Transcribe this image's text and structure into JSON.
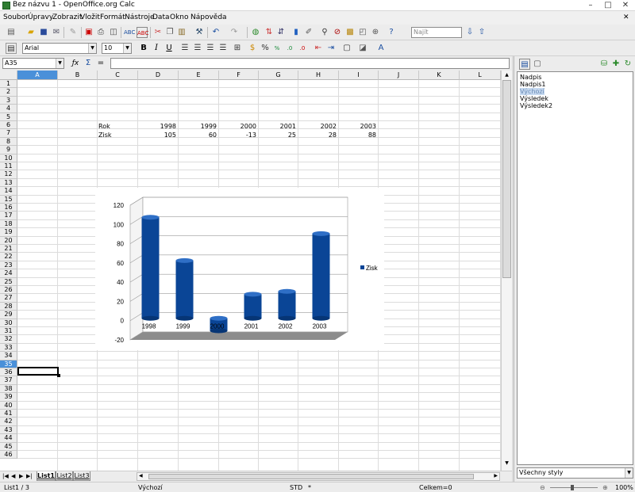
{
  "window": {
    "title": "Bez názvu 1 - OpenOffice.org Calc"
  },
  "menu": [
    "Soubor",
    "Úpravy",
    "Zobrazit",
    "Vložit",
    "Formát",
    "Nástroje",
    "Data",
    "Okno",
    "Nápověda"
  ],
  "toolbar": {
    "find_placeholder": "Najít"
  },
  "formatting": {
    "font_name": "Arial",
    "font_size": "10"
  },
  "formula_bar": {
    "name_box": "A35",
    "formula": ""
  },
  "sheet": {
    "columns": [
      "A",
      "B",
      "C",
      "D",
      "E",
      "F",
      "G",
      "H",
      "I",
      "J",
      "K",
      "L"
    ],
    "rows": [
      "1",
      "2",
      "3",
      "4",
      "5",
      "6",
      "7",
      "8",
      "9",
      "10",
      "11",
      "12",
      "13",
      "14",
      "15",
      "16",
      "17",
      "18",
      "19",
      "20",
      "21",
      "22",
      "23",
      "24",
      "25",
      "26",
      "27",
      "28",
      "29",
      "30",
      "31",
      "32",
      "33",
      "34",
      "35",
      "36",
      "37",
      "38",
      "39",
      "40",
      "41",
      "42",
      "43",
      "44",
      "45",
      "46"
    ],
    "selected_row": "35",
    "selected_col": "A",
    "row6": {
      "label": "Rok",
      "values": [
        "1998",
        "1999",
        "2000",
        "2001",
        "2002",
        "2003"
      ]
    },
    "row7": {
      "label": "Zisk",
      "values": [
        "105",
        "60",
        "-13",
        "25",
        "28",
        "88"
      ]
    }
  },
  "chart_data": {
    "type": "bar",
    "style": "3d-cylinder",
    "categories": [
      "1998",
      "1999",
      "2000",
      "2001",
      "2002",
      "2003"
    ],
    "series": [
      {
        "name": "Zisk",
        "values": [
          105,
          60,
          -13,
          25,
          28,
          88
        ],
        "color": "#0a4596"
      }
    ],
    "yticks": [
      "120",
      "100",
      "80",
      "60",
      "40",
      "20",
      "0",
      "-20"
    ],
    "ylim": [
      -20,
      120
    ],
    "grid": true,
    "legend": "right"
  },
  "sheet_tabs": [
    "List1",
    "List2",
    "List3"
  ],
  "status": {
    "sheet": "List1 / 3",
    "style": "Výchozí",
    "mode": "STD",
    "modified": "*",
    "sum": "Celkem=0",
    "zoom": "100%"
  },
  "stylist": {
    "items": [
      "Nadpis",
      "Nadpis1",
      "Výchozí",
      "Výsledek",
      "Výsledek2"
    ],
    "selected_index": 2,
    "filter": "Všechny styly"
  }
}
